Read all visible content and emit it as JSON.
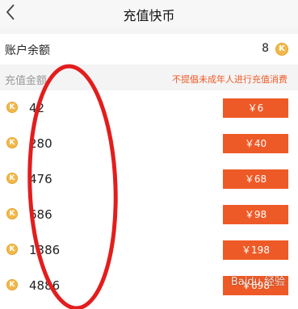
{
  "header": {
    "title": "充值快币"
  },
  "balance": {
    "label": "账户余额",
    "value": "8",
    "coin_icon": "kuaibi-coin-icon"
  },
  "section": {
    "label": "充值金额",
    "warning": "不提倡未成年人进行充值消费"
  },
  "packages": [
    {
      "amount": "42",
      "price": "￥6"
    },
    {
      "amount": "280",
      "price": "￥40"
    },
    {
      "amount": "476",
      "price": "￥68"
    },
    {
      "amount": "686",
      "price": "￥98"
    },
    {
      "amount": "1386",
      "price": "￥198"
    },
    {
      "amount": "4886",
      "price": "￥698"
    }
  ],
  "colors": {
    "accent": "#ee5a27",
    "coin": "#f2b84b",
    "annotation": "#e31d1d"
  },
  "watermark": "Baidu 经验"
}
